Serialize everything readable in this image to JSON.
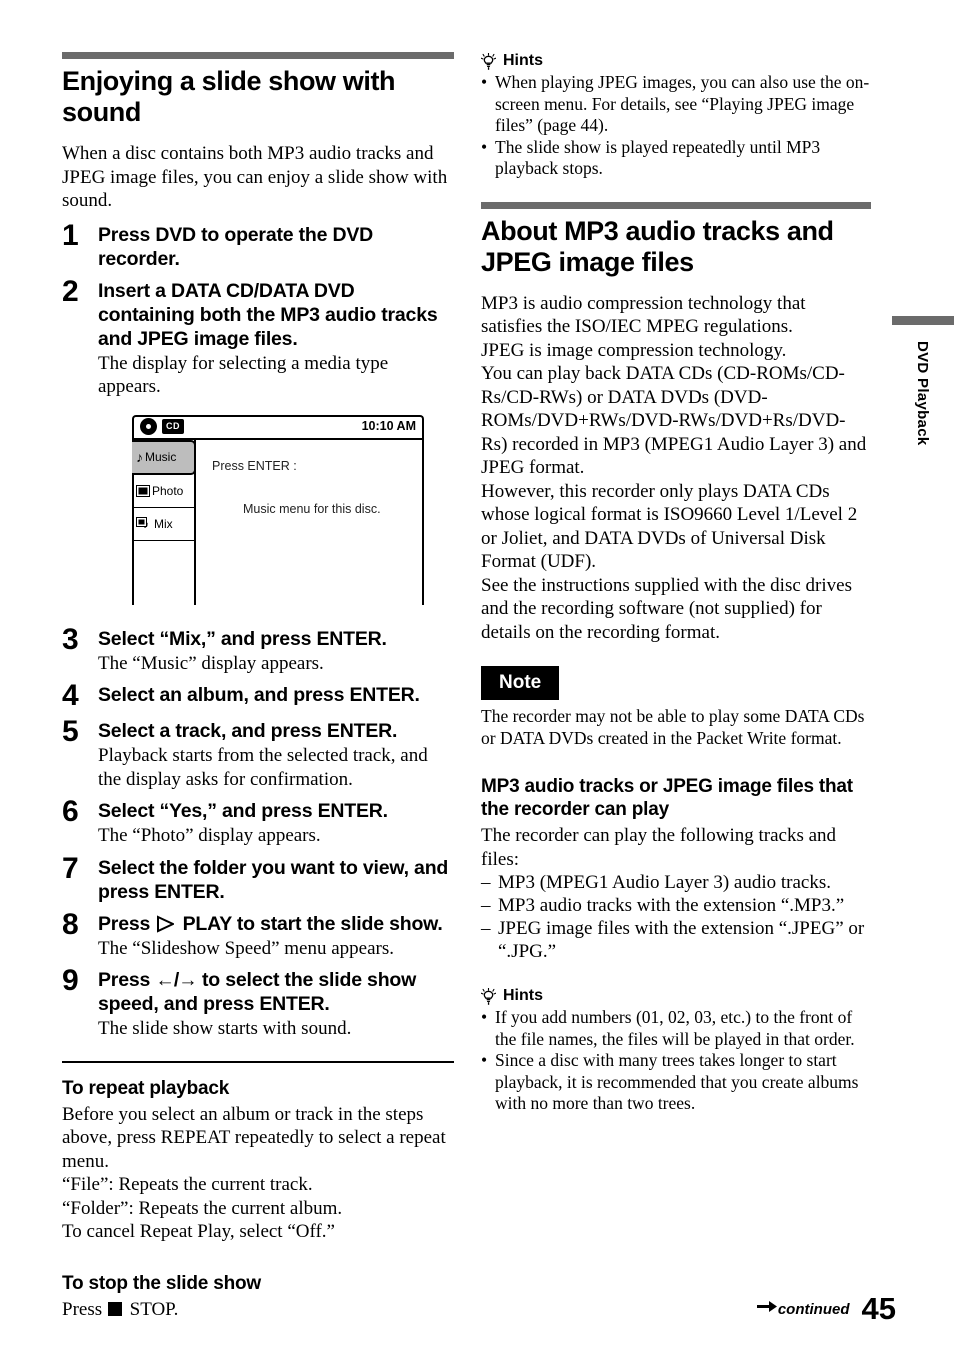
{
  "page_number": "45",
  "footer": {
    "continued_label": "continued",
    "arrow_icon": "right-arrow-icon"
  },
  "side_tab": {
    "label": "DVD Playback"
  },
  "left_column": {
    "section_title": "Enjoying a slide show with sound",
    "intro": "When a disc contains both MP3 audio tracks and JPEG image files, you can enjoy a slide show with sound.",
    "steps": [
      {
        "number": "1",
        "heading": "Press DVD to operate the DVD recorder.",
        "desc": ""
      },
      {
        "number": "2",
        "heading": "Insert a DATA CD/DATA DVD containing both the MP3 audio tracks and JPEG image files.",
        "desc": "The display for selecting a media type appears."
      },
      {
        "number": "3",
        "heading": "Select “Mix,” and press ENTER.",
        "desc": "The “Music” display appears."
      },
      {
        "number": "4",
        "heading": "Select an album, and press ENTER.",
        "desc": ""
      },
      {
        "number": "5",
        "heading": "Select a track, and press ENTER.",
        "desc": "Playback starts from the selected track, and the display asks for confirmation."
      },
      {
        "number": "6",
        "heading": "Select “Yes,” and press ENTER.",
        "desc": "The “Photo” display appears."
      },
      {
        "number": "7",
        "heading": "Select the folder you want to view, and press ENTER.",
        "desc": ""
      },
      {
        "number": "8",
        "heading_before": "Press",
        "heading_after": "PLAY to start the slide show.",
        "desc": "The “Slideshow Speed” menu appears."
      },
      {
        "number": "9",
        "heading_before": "Press",
        "heading_arrows": "←/→",
        "heading_after": "to select the slide show speed, and press ENTER.",
        "desc": "The slide show starts with sound."
      }
    ],
    "screenshot": {
      "disc_icon": "disc-icon",
      "media_badge": "CD",
      "clock": "10:10 AM",
      "menu_items": [
        {
          "icon": "music-note-icon",
          "label": "Music",
          "selected": true
        },
        {
          "icon": "photo-icon",
          "label": "Photo",
          "selected": false
        },
        {
          "icon": "mix-icon",
          "label": "Mix",
          "selected": false
        }
      ],
      "prompt": "Press ENTER :",
      "message": "Music menu for this disc."
    },
    "repeat_section": {
      "title": "To repeat playback",
      "lines": [
        "Before you select an album or track in the steps above, press REPEAT repeatedly to select a repeat menu.",
        "“File”: Repeats the current track.",
        "“Folder”: Repeats the current album.",
        "To cancel Repeat Play, select “Off.”"
      ]
    },
    "stop_section": {
      "title": "To stop the slide show",
      "press_label": "Press",
      "stop_icon": "stop-square-icon",
      "stop_label": "STOP."
    }
  },
  "right_column": {
    "hints_top": {
      "icon": "lightbulb-icon",
      "title": "Hints",
      "items": [
        "When playing JPEG images, you can also use the on-screen menu. For details, see “Playing JPEG image files” (page 44).",
        "The slide show is played repeatedly until MP3 playback stops."
      ]
    },
    "section_title": "About MP3 audio tracks and JPEG image files",
    "paragraphs": [
      "MP3 is audio compression technology that satisfies the ISO/IEC MPEG regulations.",
      "JPEG is image compression technology.",
      "You can play back DATA CDs (CD-ROMs/CD-Rs/CD-RWs) or DATA DVDs (DVD-ROMs/DVD+RWs/DVD-RWs/DVD+Rs/DVD-Rs) recorded in MP3 (MPEG1 Audio Layer 3) and JPEG format.",
      "However, this recorder only plays DATA CDs whose logical format is ISO9660 Level 1/Level 2 or Joliet, and DATA DVDs of Universal Disk Format (UDF).",
      "See the instructions supplied with the disc drives and the recording software (not supplied) for details on the recording format."
    ],
    "note": {
      "tag": "Note",
      "text": "The recorder may not be able to play some DATA CDs or DATA DVDs created in the Packet Write format."
    },
    "playable": {
      "title": "MP3 audio tracks or JPEG image files that the recorder can play",
      "intro": "The recorder can play the following tracks and files:",
      "items": [
        "MP3 (MPEG1 Audio Layer 3) audio tracks.",
        "MP3 audio tracks with the extension “.MP3.”",
        "JPEG image files with the extension “.JPEG” or “.JPG.”"
      ]
    },
    "hints_bottom": {
      "icon": "lightbulb-icon",
      "title": "Hints",
      "items": [
        "If you add numbers (01, 02, 03, etc.) to the front of the file names, the files will be played in that order.",
        "Since a disc with many trees takes longer to start playback, it is recommended that you create albums with no more than two trees."
      ]
    }
  }
}
